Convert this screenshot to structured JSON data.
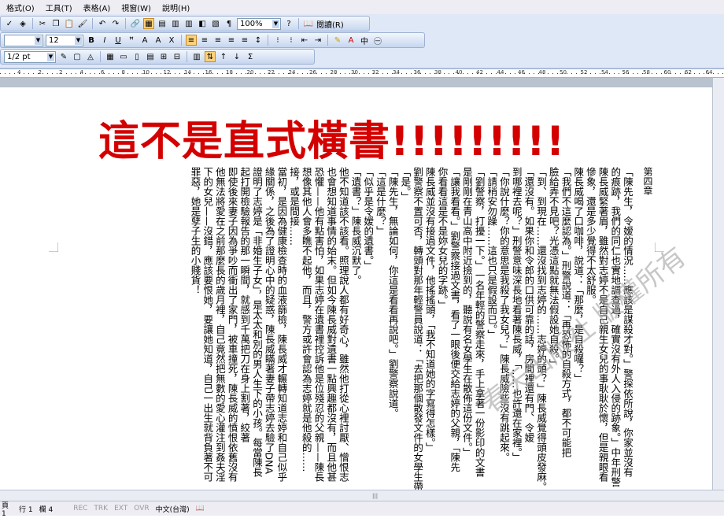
{
  "menubar": {
    "items": [
      "格式(O)",
      "工具(T)",
      "表格(A)",
      "視窗(W)",
      "說明(H)"
    ]
  },
  "toolbar1": {
    "zoom": "100%",
    "reading_label": "閱讀(R)"
  },
  "toolbar2": {
    "font_size": "12"
  },
  "toolbar3": {
    "line_width": "1/2 pt"
  },
  "ruler": {
    "numbers": [
      "4",
      "2",
      "2",
      "4",
      "6",
      "8",
      "10",
      "12",
      "14",
      "16",
      "18",
      "20",
      "22",
      "24",
      "26",
      "28",
      "30",
      "32",
      "34",
      "36",
      "38",
      "40",
      "42",
      "44",
      "46",
      "48",
      "50",
      "52",
      "54",
      "56",
      "58",
      "60",
      "62",
      "64"
    ]
  },
  "document": {
    "heading": "這不是直式橫書!!!!!!!!!",
    "chapter": "第四章",
    "columns": [
      "「陳先生，令嫒的情況……應該是謀殺才對。」警探依所說，你家並沒有",
      "的痕跡，我們的同仁也實地調查過，確實沒有外人入侵的跡象。」中年刑警",
      "陳長威緊著眉，雖然對志婷不是自己親生女兒的事耿耿於懷，但是親眼看",
      "慘象，還是多少覺得不太舒服。",
      "陳長威喝了口咖啡，說道：「那麼，是自殺囉？」",
      "「我們不這麼認為。」刑警說道：「再恐怖的自殺方式，都不可能把",
      "臉給弄不見吧？光憑這點就無法假設她自殺。」",
      "「到、到現在……還沒找到志婷的……志婷的頭？」陳長威覺得頭皮發麻。",
      "「還沒有。如果你和令郎的口供可靠的話，房間裡還有門、令嫒",
      "到哪裡去呢？」刑警意味深長地看著陳長威，「……也許還在家裡。」",
      "「你說什麼？你的意思是我殺了我女兒？」陳長威險些沒有跳起來。",
      "「請稍安勿躁……這也只是假設而已。」",
      "「劉警察，打擾一下。」一名年輕的警察走來，手上拿著一份影印的文書",
      "是剛剛在青山高中附近撿到的，聽說有名女學生在散佈這份文件。」",
      "「讓我看看。」劉警察接過文書，看了一眼後便交給志婷的父親，「陳先",
      "你看看這是不是妳女兒的字跡。」",
      "陳長威並沒有接過文件，他搖搖頭，「我不知道她的字寫得怎樣。」",
      "劉警察不置可否，轉頭對那年輕警員說道：「去把那個散發文件的女學生帶",
      "「是。」",
      "「陳先生，無論如何，你這是看看再說吧。」劉警察說道。",
      "「這是什麼？」",
      "「似乎是令嫒的遺書。」",
      "「遺書？」陳長威沉默了。",
      "他不知道該不該看。照理說人都有好奇心，雖然他打從心裡討厭、憎恨志",
      "也會想知道事情的始末。但如今陳長威對遺書一點興趣都沒有，而且他甚",
      "恐懼——他有點害怕，如果志婷在遺書裡控訴他是位殘忍的父親——陳長",
      "想像其他人會多瞧不起他，而且，警方或許會認為志婷就是他殺的……",
      "接，或是間接……",
      "當初，是因為健康檢查時的血液篩檢，陳長威才輾轉知道志婷和自己似乎",
      "緣關係，之後為了證明心中的疑惑，陳長威瞞著妻子帶志婷去驗了DNA",
      "證明了志婷是「非婚生子女」，是太太和別的男人生下的小孩。每當陳長",
      "起打開檢驗報告的那一瞬間，就感到千萬把刀在身上割著，絞著",
      "即使後來妻子因為爭吵而衝出了家門，被車撞死，陳長威的憤恨依舊沒有",
      "他無法將愛在之前那麼長的歲月裡，自己竟然把無數的愛心灌注到姦夫淫",
      "下的女兒——沒錯，應該要恨她，要讓她知道，自己一出生就背負著不可",
      "罪惡，她是孽子生的小賤貨！"
    ],
    "watermark": "春天出版社 版權所有"
  },
  "statusbar": {
    "page": "頁 1",
    "line": "行 1",
    "col": "欄 4",
    "rec": "REC",
    "trk": "TRK",
    "ext": "EXT",
    "ovr": "OVR",
    "lang": "中文(台灣)"
  },
  "colors": {
    "heading": "#d40000",
    "toolbar_bg": "#c6d6ef",
    "menubar_bg": "#eeedf3"
  }
}
